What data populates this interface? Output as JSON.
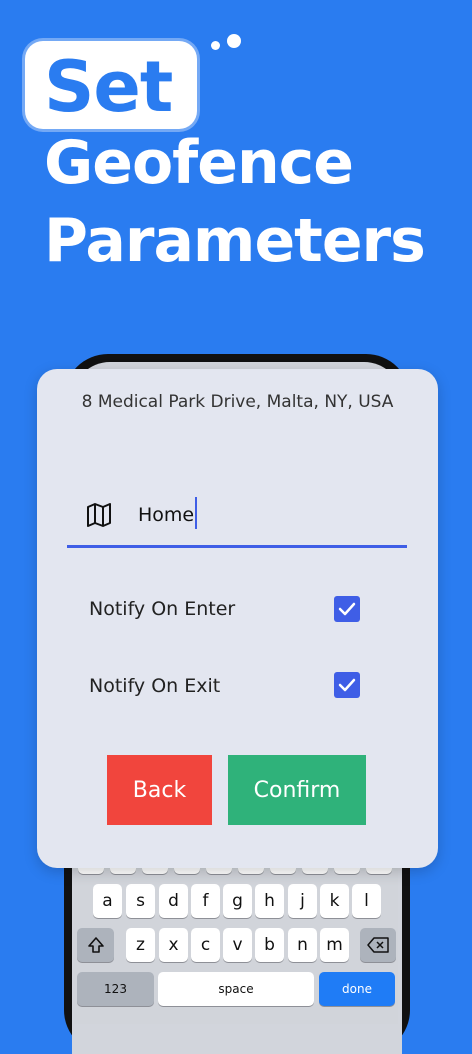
{
  "headline": {
    "word1": "Set",
    "line2": "Geofence",
    "line3": "Parameters"
  },
  "dialog": {
    "address": "8 Medical Park Drive, Malta, NY, USA",
    "name_icon": "map-icon",
    "name_value": "Home",
    "notify_enter_label": "Notify On Enter",
    "notify_enter_checked": true,
    "notify_exit_label": "Notify On Exit",
    "notify_exit_checked": true,
    "back_label": "Back",
    "confirm_label": "Confirm"
  },
  "keyboard": {
    "row2": [
      "a",
      "s",
      "d",
      "f",
      "g",
      "h",
      "j",
      "k",
      "l"
    ],
    "row3": [
      "z",
      "x",
      "c",
      "v",
      "b",
      "n",
      "m"
    ],
    "numbers_key": "123",
    "space_key": "space",
    "done_key": "done"
  },
  "colors": {
    "background": "#2a7cf0",
    "accent": "#3f5ee6",
    "back_button": "#f1453d",
    "confirm_button": "#2fb27a"
  }
}
